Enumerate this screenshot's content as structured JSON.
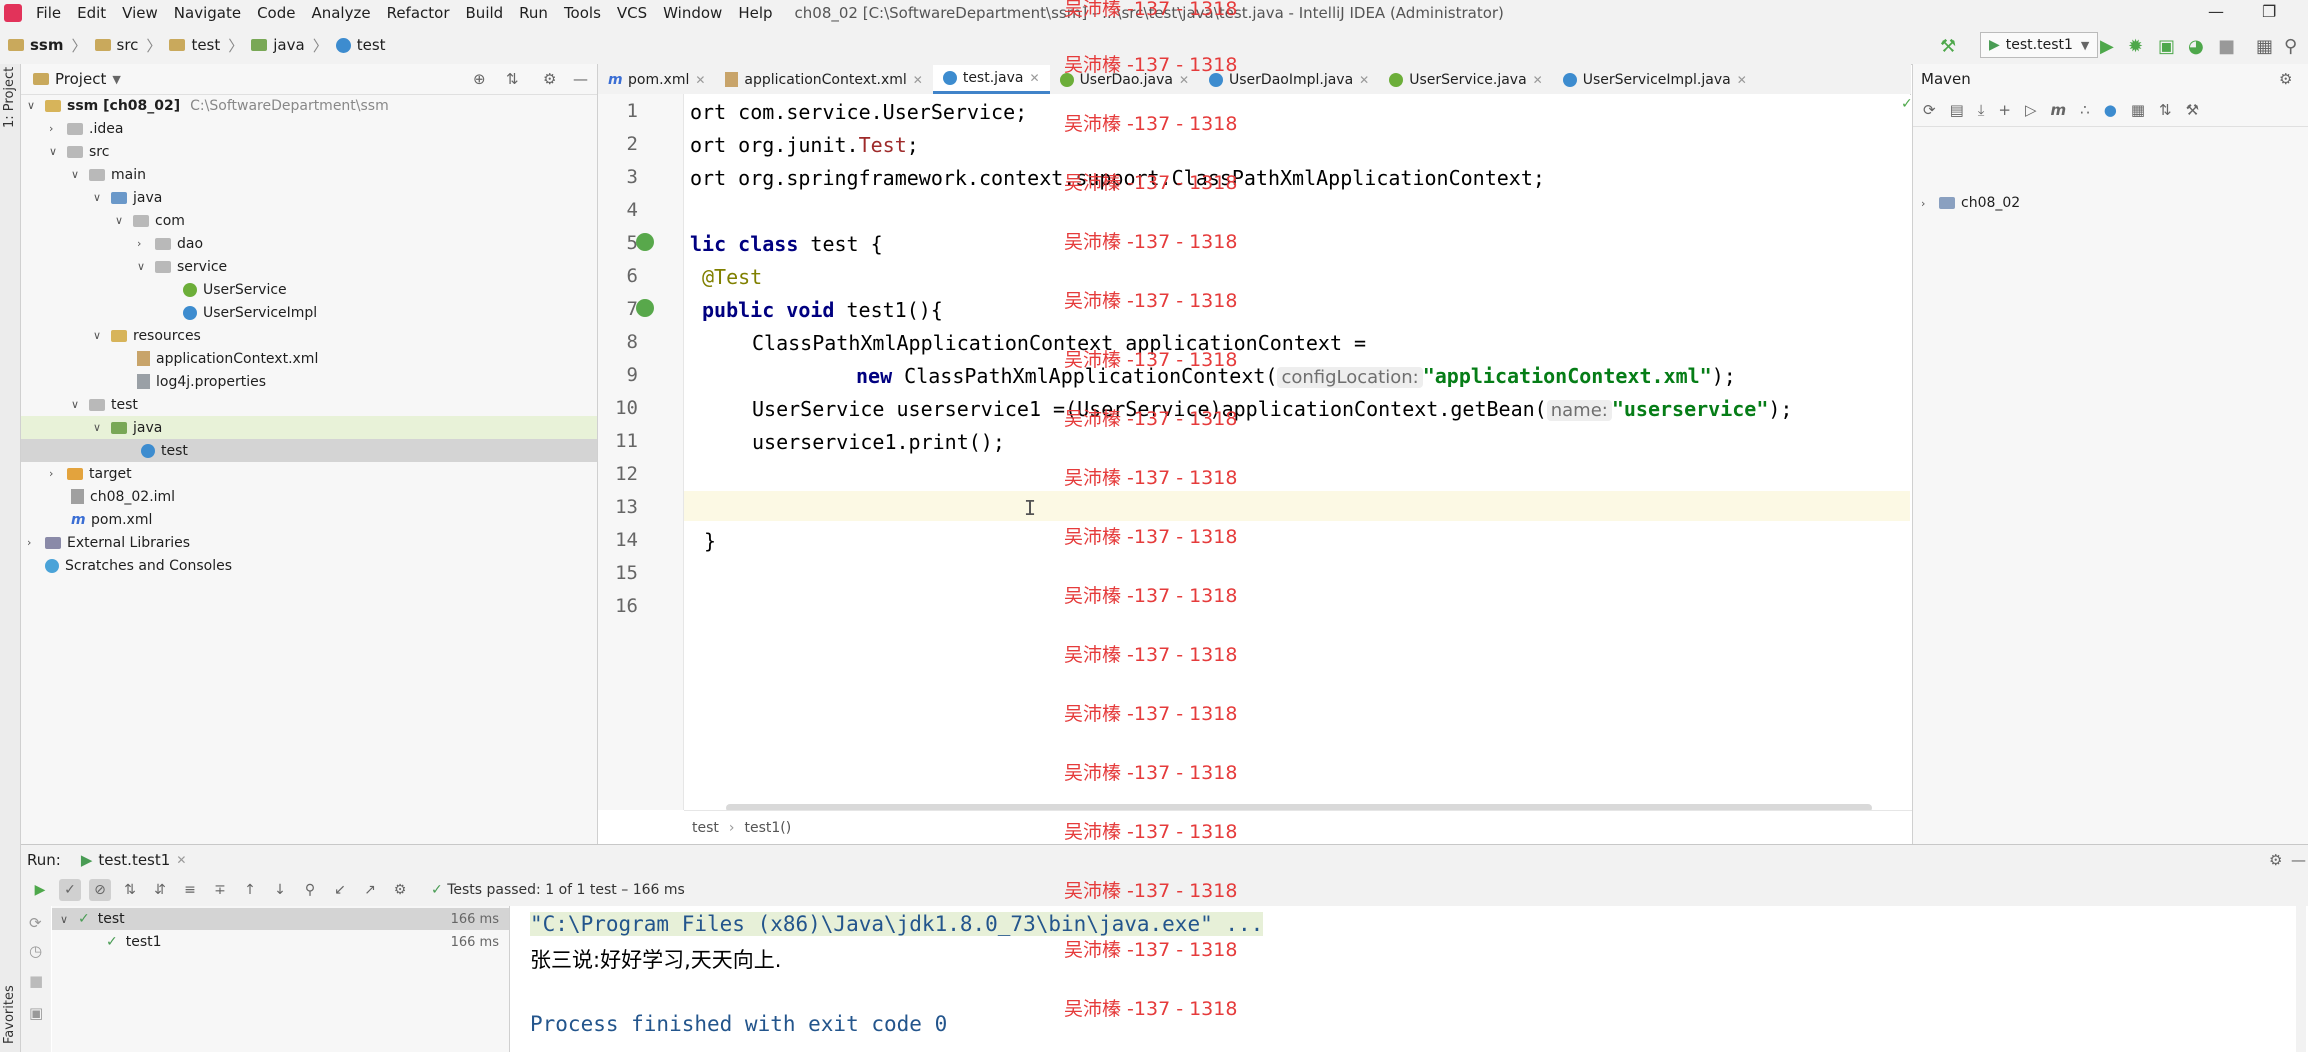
{
  "menubar": {
    "items": [
      "File",
      "Edit",
      "View",
      "Navigate",
      "Code",
      "Analyze",
      "Refactor",
      "Build",
      "Run",
      "Tools",
      "VCS",
      "Window",
      "Help"
    ],
    "title": "ch08_02 [C:\\SoftwareDepartment\\ssm] - ...\\src\\test\\java\\test.java - IntelliJ IDEA (Administrator)"
  },
  "navbar": {
    "crumbs": [
      "ssm",
      "src",
      "test",
      "java",
      "test"
    ],
    "run_config": "test.test1"
  },
  "sidebar_strip": {
    "label": "1: Project",
    "bottom_label": "Favorites"
  },
  "project": {
    "header": "Project",
    "items": [
      {
        "label": "ssm [ch08_02]",
        "extra": "C:\\SoftwareDepartment\\ssm"
      },
      {
        "label": ".idea"
      },
      {
        "label": "src"
      },
      {
        "label": "main"
      },
      {
        "label": "java"
      },
      {
        "label": "com"
      },
      {
        "label": "dao"
      },
      {
        "label": "service"
      },
      {
        "label": "UserService"
      },
      {
        "label": "UserServiceImpl"
      },
      {
        "label": "resources"
      },
      {
        "label": "applicationContext.xml"
      },
      {
        "label": "log4j.properties"
      },
      {
        "label": "test"
      },
      {
        "label": "java"
      },
      {
        "label": "test"
      },
      {
        "label": "target"
      },
      {
        "label": "ch08_02.iml"
      },
      {
        "label": "pom.xml"
      },
      {
        "label": "External Libraries"
      },
      {
        "label": "Scratches and Consoles"
      }
    ]
  },
  "editor": {
    "tabs": [
      "pom.xml",
      "applicationContext.xml",
      "test.java",
      "UserDao.java",
      "UserDaoImpl.java",
      "UserService.java",
      "UserServiceImpl.java"
    ],
    "active_tab": "test.java",
    "line_numbers": [
      "1",
      "2",
      "3",
      "4",
      "5",
      "6",
      "7",
      "8",
      "9",
      "10",
      "11",
      "12",
      "13",
      "14",
      "15",
      "16"
    ],
    "code": {
      "l1": "ort com.service.UserService;",
      "l2a": "ort org.junit.",
      "l2b": "Test",
      "l2c": ";",
      "l3": "ort org.springframework.context.support.ClassPathXmlApplicationContext;",
      "l5a": "lic ",
      "l5b": "class",
      "l5c": " test {",
      "l6": "@Test",
      "l7a": "public void",
      "l7b": " test1(){",
      "l8": "ClassPathXmlApplicationContext applicationContext =",
      "l9a": "new",
      "l9b": " ClassPathXmlApplicationContext(",
      "l9hint": "configLocation:",
      "l9str": "\"applicationContext.xml\"",
      "l9end": ");",
      "l10a": "UserService userservice1 =(UserService)applicationContext.getBean(",
      "l10hint": "name:",
      "l10str": "\"userservice\"",
      "l10end": ");",
      "l11": "userservice1.print();",
      "l14": "}"
    },
    "breadcrumb": [
      "test",
      "test1()"
    ]
  },
  "maven": {
    "header": "Maven",
    "project": "ch08_02"
  },
  "run": {
    "label": "Run:",
    "tab": "test.test1",
    "status_prefix": "Tests passed:",
    "status_count": "1",
    "status_suffix": "of 1 test – 166 ms",
    "tree": [
      {
        "label": "test",
        "time": "166 ms"
      },
      {
        "label": "test1",
        "time": "166 ms"
      }
    ],
    "console": [
      "\"C:\\Program Files (x86)\\Java\\jdk1.8.0_73\\bin\\java.exe\" ...",
      "张三说:好好学习,天天向上.",
      "Process finished with exit code 0"
    ]
  },
  "watermark": {
    "text": "吴沛榛 -137 - 1318",
    "color": "#e53b3b"
  }
}
